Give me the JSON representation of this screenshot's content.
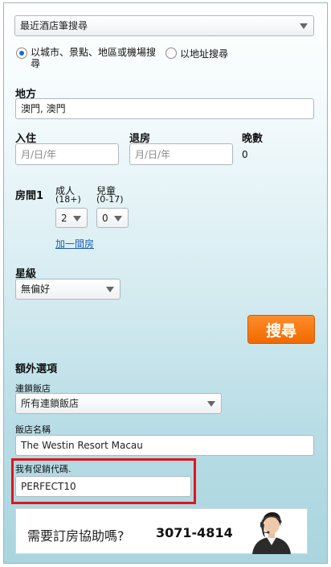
{
  "search_type": {
    "selected": "最近酒店筆搜尋"
  },
  "search_mode": {
    "option_city": "以城市、景點、地區或機場搜尋",
    "option_address": "以地址搜尋"
  },
  "destination": {
    "label": "地方",
    "value": "澳門, 澳門"
  },
  "dates": {
    "checkin_label": "入住",
    "checkout_label": "退房",
    "checkin_placeholder": "月/日/年",
    "checkout_placeholder": "月/日/年",
    "nights_label": "晚數",
    "nights_value": "0"
  },
  "rooms": {
    "room_label": "房間1",
    "adults_label": "成人",
    "adults_range": "(18+)",
    "children_label": "兒童",
    "children_range": "(0-17)",
    "adults_value": "2",
    "children_value": "0",
    "add_room_link": "加一間房"
  },
  "star_rating": {
    "label": "星級",
    "value": "無偏好"
  },
  "search_button": "搜尋",
  "extra_options": {
    "title": "額外選項",
    "chain_label": "連鎖飯店",
    "chain_value": "所有連鎖飯店",
    "hotel_name_label": "飯店名稱",
    "hotel_name_value": "The Westin Resort Macau",
    "promo_label": "我有促銷代碼.",
    "promo_value": "PERFECT10"
  },
  "help_banner": {
    "text": "需要訂房協助嗎?",
    "phone": "3071-4814"
  },
  "colors": {
    "accent_orange": "#f07800",
    "highlight_red": "#e0151b",
    "link_blue": "#1a5fb4"
  }
}
